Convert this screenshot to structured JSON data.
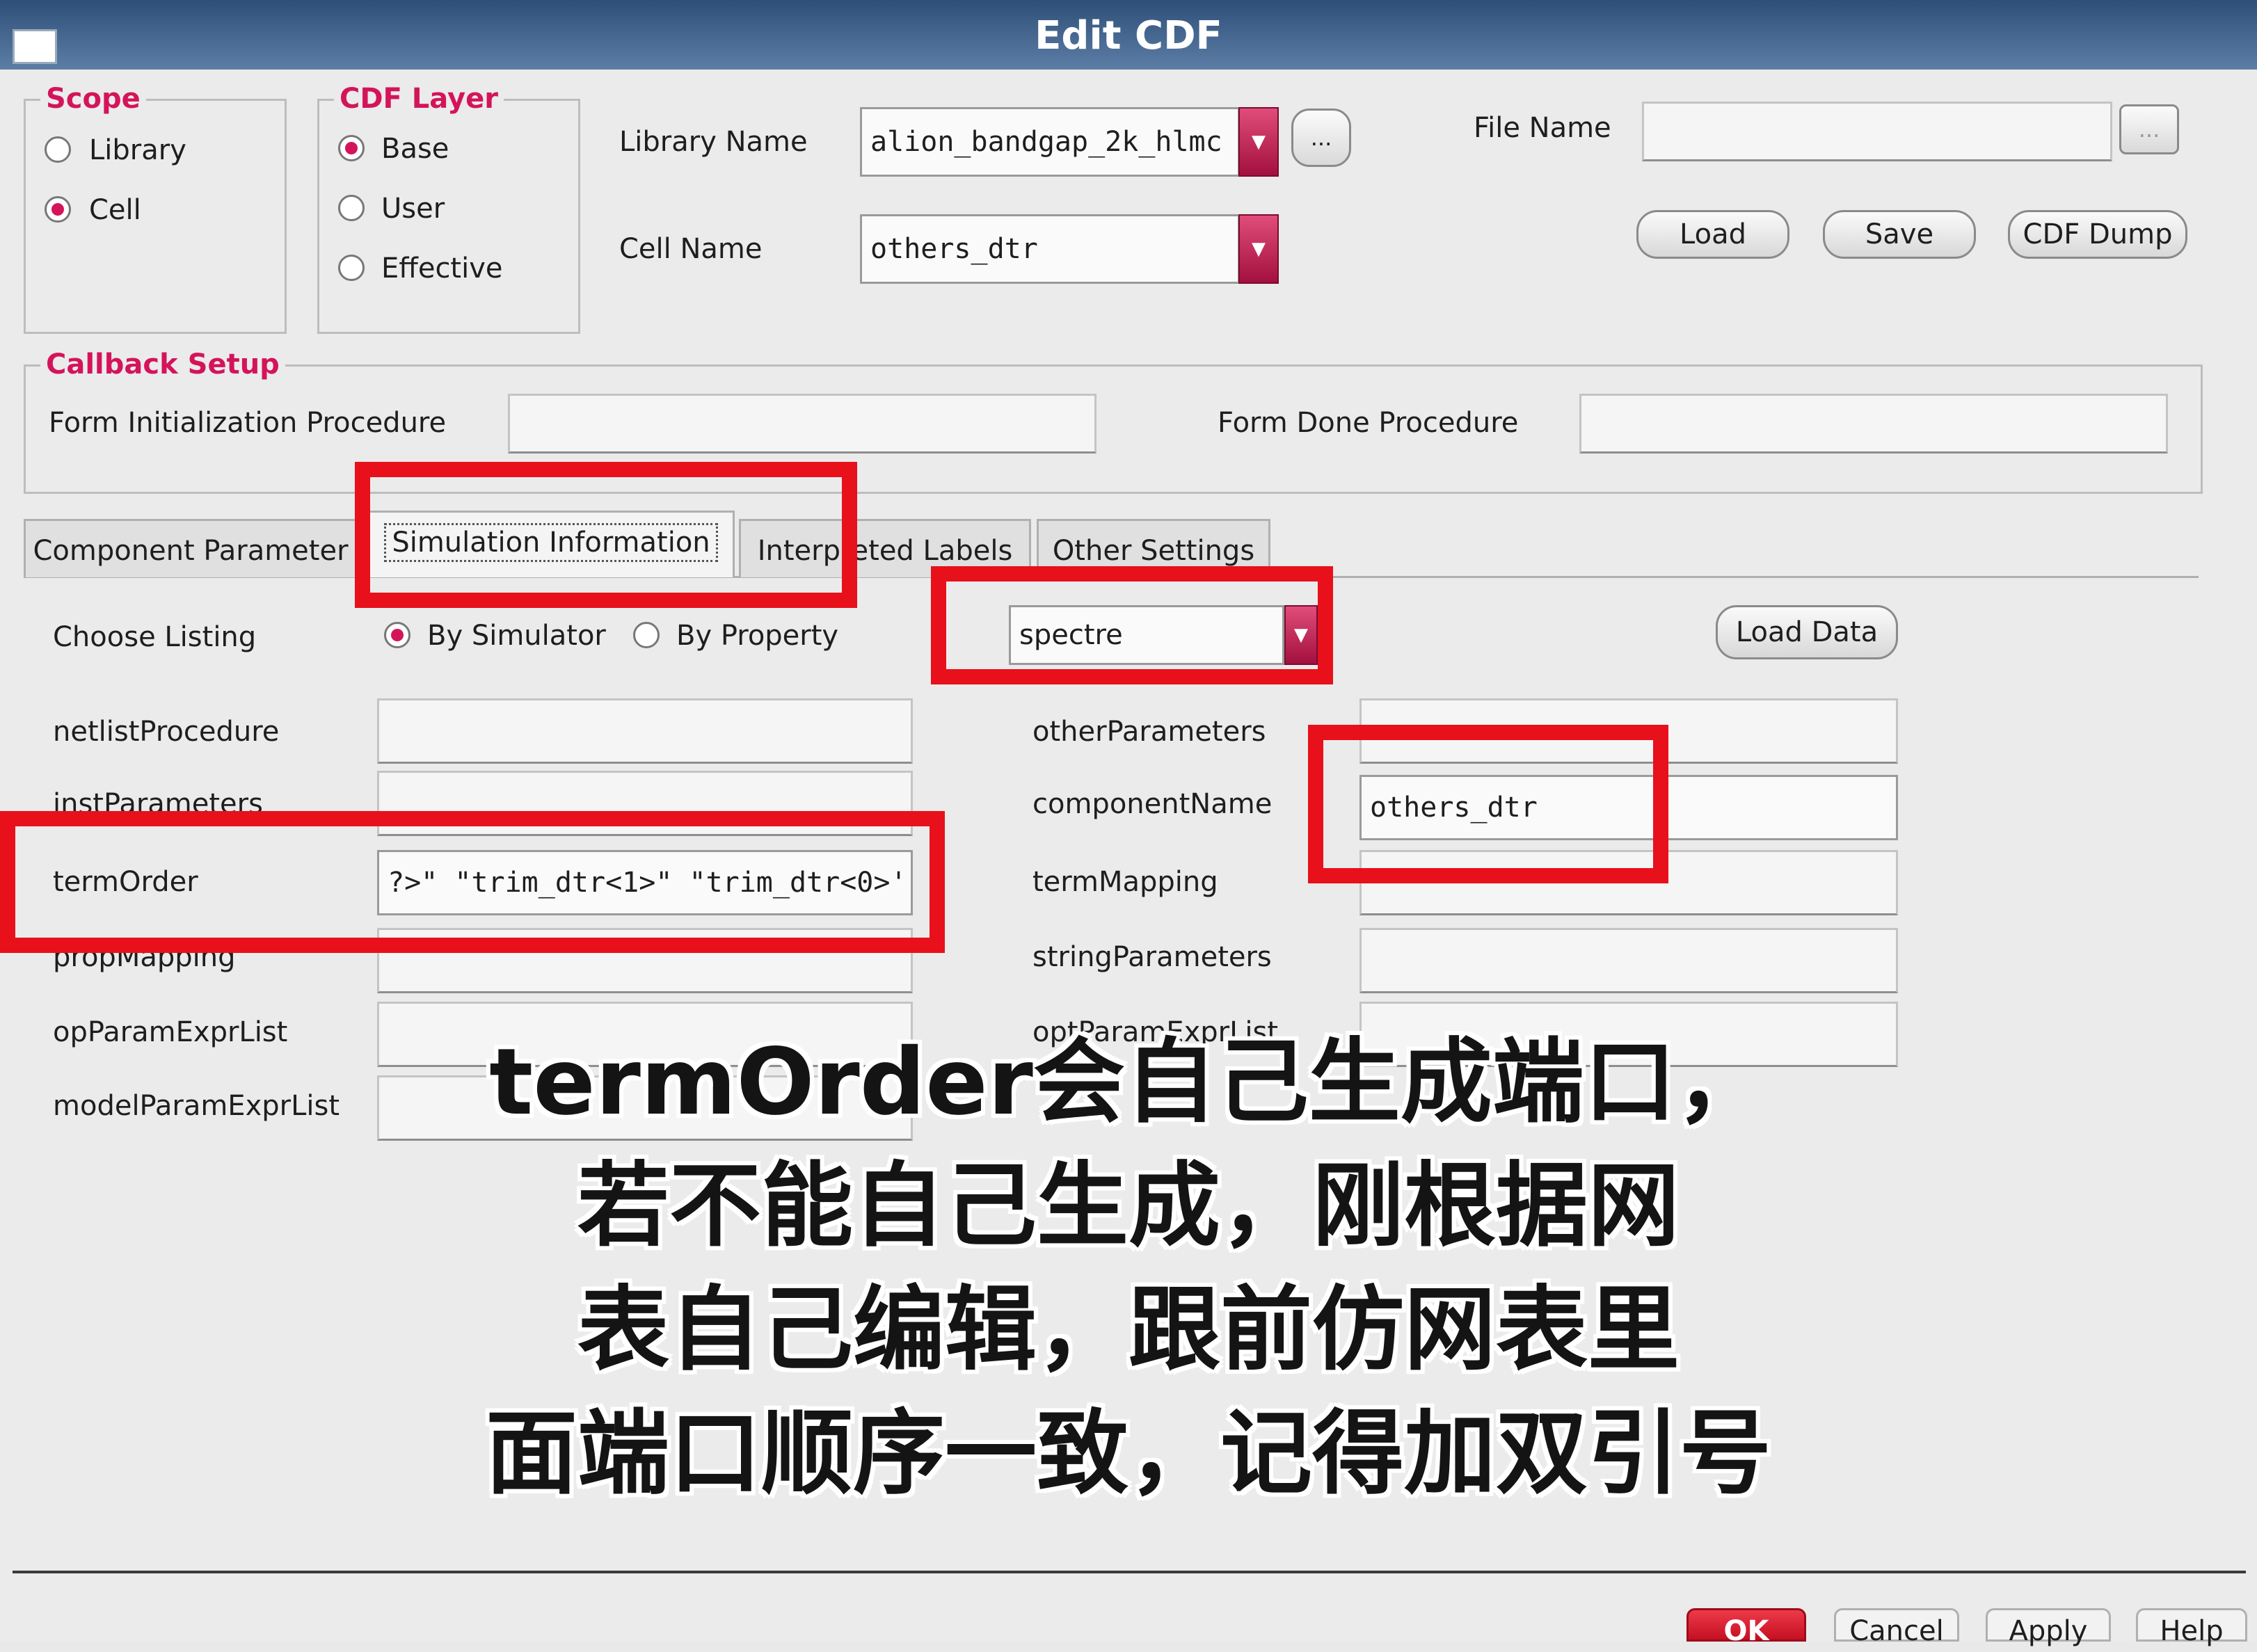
{
  "window": {
    "title": "Edit CDF"
  },
  "scope": {
    "legend": "Scope",
    "options": [
      "Library",
      "Cell"
    ],
    "selected": "Cell"
  },
  "cdf_layer": {
    "legend": "CDF Layer",
    "options": [
      "Base",
      "User",
      "Effective"
    ],
    "selected": "Base"
  },
  "library": {
    "label": "Library Name",
    "value": "alion_bandgap_2k_hlmc",
    "browse": "..."
  },
  "cell": {
    "label": "Cell Name",
    "value": "others_dtr"
  },
  "file": {
    "label": "File Name",
    "value": "",
    "browse": "..."
  },
  "actions": {
    "load": "Load",
    "save": "Save",
    "dump": "CDF Dump"
  },
  "callback": {
    "legend": "Callback Setup",
    "init_label": "Form Initialization Procedure",
    "done_label": "Form Done Procedure"
  },
  "tabs": [
    "Component Parameter",
    "Simulation Information",
    "Interpreted Labels",
    "Other Settings"
  ],
  "active_tab": "Simulation Information",
  "listing": {
    "label": "Choose Listing",
    "options": [
      "By Simulator",
      "By Property"
    ],
    "selected": "By Simulator",
    "simulator": "spectre",
    "load_data": "Load Data"
  },
  "left_fields": [
    {
      "label": "netlistProcedure",
      "value": ""
    },
    {
      "label": "instParameters",
      "value": ""
    },
    {
      "label": "termOrder",
      "value": "?>\" \"trim_dtr<1>\" \"trim_dtr<0>'"
    },
    {
      "label": "propMapping",
      "value": ""
    },
    {
      "label": "opParamExprList",
      "value": ""
    },
    {
      "label": "modelParamExprList",
      "value": ""
    }
  ],
  "right_fields": [
    {
      "label": "otherParameters",
      "value": ""
    },
    {
      "label": "componentName",
      "value": "others_dtr"
    },
    {
      "label": "termMapping",
      "value": ""
    },
    {
      "label": "stringParameters",
      "value": ""
    },
    {
      "label": "optParamExprList",
      "value": ""
    }
  ],
  "annotation_lines": [
    "termOrder会自己生成端口，",
    "若不能自己生成，刚根据网",
    "表自己编辑，跟前仿网表里",
    "面端口顺序一致，记得加双引号"
  ],
  "bottom_buttons": [
    "OK",
    "Cancel",
    "Apply",
    "Help"
  ],
  "colors": {
    "accent": "#d4145a",
    "highlight": "#e8101a",
    "title_bar": "#3d5f8a"
  },
  "icons": [
    "window-icon",
    "dropdown-arrow-icon",
    "ellipsis-icon"
  ]
}
